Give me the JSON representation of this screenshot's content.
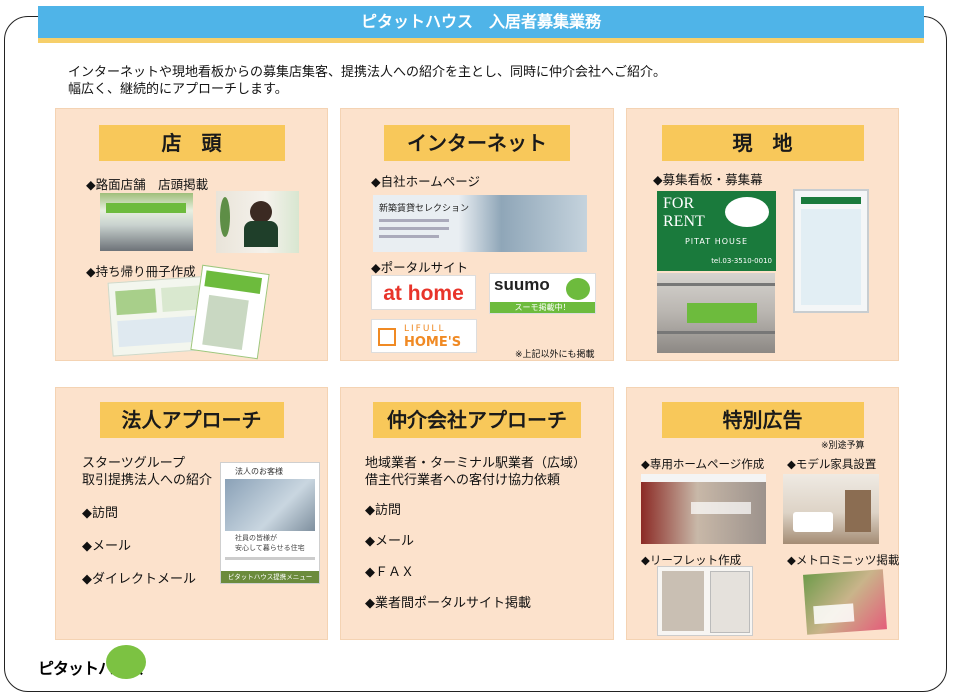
{
  "header": {
    "title": "ピタットハウス　入居者募集業務"
  },
  "intro": {
    "line1": "インターネットや現地看板からの募集店集客、提携法人への紹介を主とし、同時に仲介会社へご紹介。",
    "line2": "幅広く、継続的にアプローチします。"
  },
  "panels": {
    "storefront": {
      "heading": "店　頭",
      "item1": "◆路面店舗　店頭掲載",
      "item2": "◆持ち帰り冊子作成"
    },
    "internet": {
      "heading": "インターネット",
      "item1": "◆自社ホームページ",
      "item2": "◆ポータルサイト",
      "banner_text": "新築賃貸セレクション",
      "athome": "at home",
      "suumo": "suumo",
      "suumo_sub": "スーモ掲載中！",
      "homes_top": "LIFULL",
      "homes_bottom": "HOME'S",
      "note": "※上記以外にも掲載"
    },
    "onsite": {
      "heading": "現　地",
      "item1": "◆募集看板・募集幕",
      "sign_line1": "FOR",
      "sign_line2": "RENT",
      "sign_brand": "PITAT HOUSE",
      "sign_tel": "tel.03-3510-0010"
    },
    "corporate": {
      "heading": "法人アプローチ",
      "desc1": "スターツグループ",
      "desc2": "取引提携法人への紹介",
      "m1": "◆訪問",
      "m2": "◆メール",
      "m3": "◆ダイレクトメール",
      "flyer_head": "法人のお客様",
      "flyer_tag": "社員の皆様が\n安心して暮らせる住宅",
      "flyer_bottom": "ピタットハウス提携メニュー"
    },
    "broker": {
      "heading": "仲介会社アプローチ",
      "desc1": "地域業者・ターミナル駅業者（広域）",
      "desc2": "借主代行業者への客付け協力依頼",
      "m1": "◆訪問",
      "m2": "◆メール",
      "m3": "◆ＦＡＸ",
      "m4": "◆業者間ポータルサイト掲載"
    },
    "special": {
      "heading": "特別広告",
      "note": "※別途予算",
      "item1": "◆専用ホームページ作成",
      "item2": "◆モデル家具設置",
      "item3": "◆リーフレット作成",
      "item4": "◆メトロミニッツ掲載"
    }
  },
  "footer": {
    "logo_text": "ピタットハウス"
  },
  "colors": {
    "title_blue": "#4fb4e8",
    "accent_yellow": "#f8c85a",
    "panel_bg": "#fce2cc",
    "brand_green": "#7cc242"
  }
}
